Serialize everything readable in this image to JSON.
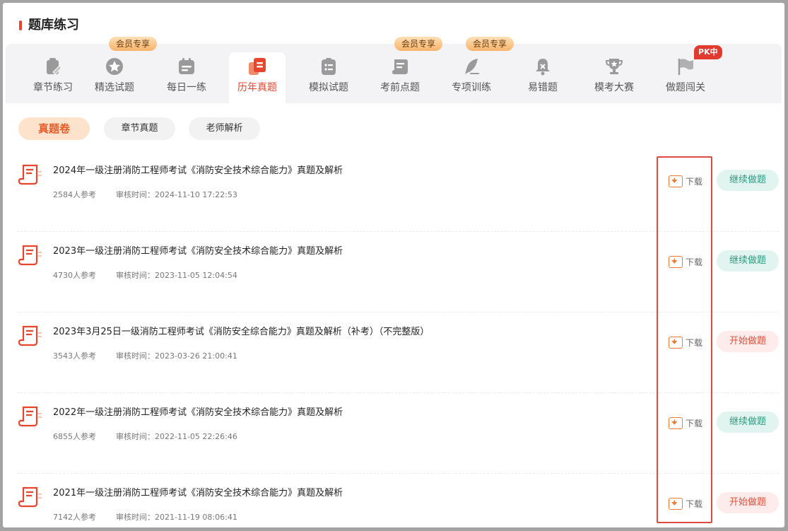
{
  "header": {
    "title": "题库练习"
  },
  "tabs": [
    {
      "label": "章节练习",
      "icon": "clipboard-pen-icon"
    },
    {
      "label": "精选试题",
      "icon": "star-badge-icon",
      "badge": "会员专享"
    },
    {
      "label": "每日一练",
      "icon": "calendar-icon"
    },
    {
      "label": "历年真题",
      "icon": "document-stack-icon",
      "active": true
    },
    {
      "label": "模拟试题",
      "icon": "checklist-icon"
    },
    {
      "label": "考前点题",
      "icon": "scroll-icon",
      "badge": "会员专享"
    },
    {
      "label": "专项训练",
      "icon": "feather-pen-icon",
      "badge": "会员专享"
    },
    {
      "label": "易错题",
      "icon": "bell-icon"
    },
    {
      "label": "模考大赛",
      "icon": "trophy-icon"
    },
    {
      "label": "做题闯关",
      "icon": "flag-icon",
      "badge": "PK中"
    }
  ],
  "subtabs": [
    {
      "label": "真题卷",
      "active": true
    },
    {
      "label": "章节真题"
    },
    {
      "label": "老师解析"
    }
  ],
  "list": {
    "download_label": "下载",
    "items": [
      {
        "title": "2024年一级注册消防工程师考试《消防安全技术综合能力》真题及解析",
        "participants": "2584人参考",
        "review_time": "审核时间：2024-11-10 17:22:53",
        "action": "继续做题",
        "action_type": "cont"
      },
      {
        "title": "2023年一级注册消防工程师考试《消防安全技术综合能力》真题及解析",
        "participants": "4730人参考",
        "review_time": "审核时间：2023-11-05 12:04:54",
        "action": "继续做题",
        "action_type": "cont"
      },
      {
        "title": "2023年3月25日一级消防工程师考试《消防安全综合能力》真题及解析（补考）（不完整版）",
        "participants": "3543人参考",
        "review_time": "审核时间：2023-03-26 21:00:41",
        "action": "开始做题",
        "action_type": "start"
      },
      {
        "title": "2022年一级注册消防工程师考试《消防安全技术综合能力》真题及解析",
        "participants": "6855人参考",
        "review_time": "审核时间：2022-11-05 22:26:46",
        "action": "继续做题",
        "action_type": "cont"
      },
      {
        "title": "2021年一级注册消防工程师考试《消防安全技术综合能力》真题及解析",
        "participants": "7142人参考",
        "review_time": "审核时间：2021-11-19 08:06:41",
        "action": "开始做题",
        "action_type": "start"
      }
    ]
  },
  "colors": {
    "accent": "#e8452c",
    "download": "#f07a32",
    "continue": "#2d9b7f",
    "start": "#e0523d"
  }
}
